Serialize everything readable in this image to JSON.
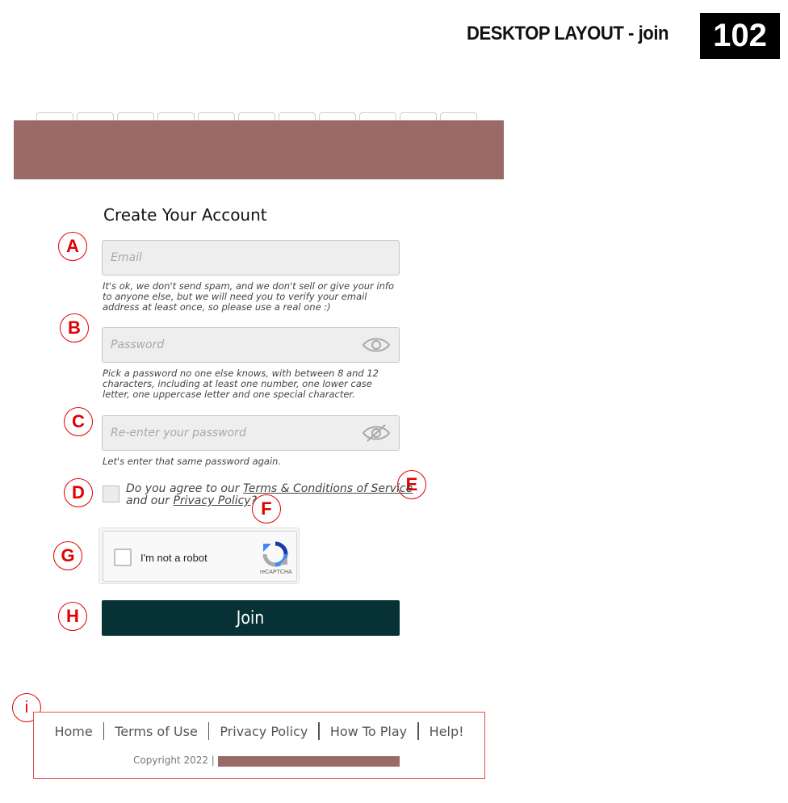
{
  "doc": {
    "heading": "DESKTOP LAYOUT - join",
    "page_number": "102"
  },
  "header": {
    "band_color": "#9a6a67",
    "tab_count": 11
  },
  "form": {
    "title": "Create Your Account",
    "email": {
      "placeholder": "Email",
      "hint": "It's ok, we don't send spam, and we don't sell or give your info to anyone else, but we will need you to verify your email address at least once, so please use a real one :)"
    },
    "password": {
      "placeholder": "Password",
      "icon": "eye-icon",
      "hint": "Pick a password no one else knows, with between 8 and 12 characters, including at least one number, one lower case letter, one uppercase letter and one special character."
    },
    "confirm": {
      "placeholder": "Re-enter your password",
      "icon": "eye-slash-icon",
      "hint": "Let's enter that same password again."
    },
    "agree": {
      "prefix": "Do you agree to our ",
      "terms_link": "Terms & Conditions of Service",
      "middle": "and our ",
      "privacy_link": "Privacy Policy",
      "suffix": "?"
    },
    "captcha": {
      "label": "I'm not a robot",
      "brand": "reCAPTCHA"
    },
    "join_label": "Join"
  },
  "annotations": {
    "a": "A",
    "b": "B",
    "c": "C",
    "d": "D",
    "e": "E",
    "f": "F",
    "g": "G",
    "h": "H",
    "i": "i",
    "color": "#e00000"
  },
  "footer": {
    "links": [
      "Home",
      "Terms of Use",
      "Privacy Policy",
      "How To Play",
      "Help!"
    ],
    "copyright": "Copyright 2022 |"
  },
  "colors": {
    "accent": "#9a6a67",
    "button": "#063236"
  }
}
